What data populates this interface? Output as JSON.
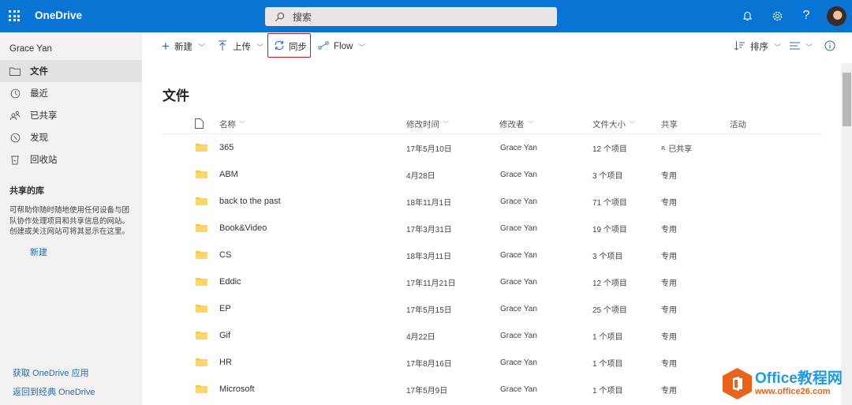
{
  "app": {
    "title": "OneDrive"
  },
  "search": {
    "placeholder": "搜索"
  },
  "user": {
    "name": "Grace Yan"
  },
  "sidebar": {
    "items": [
      {
        "label": "文件",
        "icon": "folder-icon",
        "active": true
      },
      {
        "label": "最近",
        "icon": "clock-icon"
      },
      {
        "label": "已共享",
        "icon": "people-icon"
      },
      {
        "label": "发现",
        "icon": "compass-icon"
      },
      {
        "label": "回收站",
        "icon": "recycle-bin-icon"
      }
    ],
    "shared_libraries": {
      "title": "共享的库",
      "description": "可帮助你随时随地使用任何设备与团队协作处理项目和共享信息的网站。创建或关注网站可将其显示在这里。",
      "new_label": "新建"
    },
    "footer_links": [
      "获取 OneDrive 应用",
      "返回到经典 OneDrive"
    ]
  },
  "toolbar": {
    "new_label": "新建",
    "upload_label": "上传",
    "sync_label": "同步",
    "flow_label": "Flow",
    "sort_label": "排序"
  },
  "main": {
    "title": "文件",
    "columns": {
      "name": "名称",
      "modified": "修改时间",
      "modified_by": "修改者",
      "size": "文件大小",
      "sharing": "共享",
      "activity": "活动"
    },
    "rows": [
      {
        "name": "365",
        "modified": "17年5月10日",
        "modified_by": "Grace Yan",
        "size": "12 个项目",
        "sharing": "已共享",
        "shared": true
      },
      {
        "name": "ABM",
        "modified": "4月28日",
        "modified_by": "Grace Yan",
        "size": "3 个项目",
        "sharing": "专用"
      },
      {
        "name": "back to the past",
        "modified": "18年11月1日",
        "modified_by": "Grace Yan",
        "size": "71 个项目",
        "sharing": "专用"
      },
      {
        "name": "Book&Video",
        "modified": "17年3月31日",
        "modified_by": "Grace Yan",
        "size": "19 个项目",
        "sharing": "专用"
      },
      {
        "name": "CS",
        "modified": "18年3月11日",
        "modified_by": "Grace Yan",
        "size": "3 个项目",
        "sharing": "专用"
      },
      {
        "name": "Eddic",
        "modified": "17年11月21日",
        "modified_by": "Grace Yan",
        "size": "12 个项目",
        "sharing": "专用"
      },
      {
        "name": "EP",
        "modified": "17年5月15日",
        "modified_by": "Grace Yan",
        "size": "25 个项目",
        "sharing": "专用"
      },
      {
        "name": "Gif",
        "modified": "4月22日",
        "modified_by": "Grace Yan",
        "size": "1 个项目",
        "sharing": "专用"
      },
      {
        "name": "HR",
        "modified": "17年8月16日",
        "modified_by": "Grace Yan",
        "size": "1 个项目",
        "sharing": "专用"
      },
      {
        "name": "Microsoft",
        "modified": "17年5月9日",
        "modified_by": "Grace Yan",
        "size": "1 个项目",
        "sharing": "专用"
      }
    ]
  },
  "watermark": {
    "line1": "Office教程网",
    "line2": "www.office26.com"
  },
  "colors": {
    "brand": "#0a74d4",
    "highlight_border": "#c8161d",
    "folder": "#f5c84c",
    "link": "#2a6bb0"
  }
}
